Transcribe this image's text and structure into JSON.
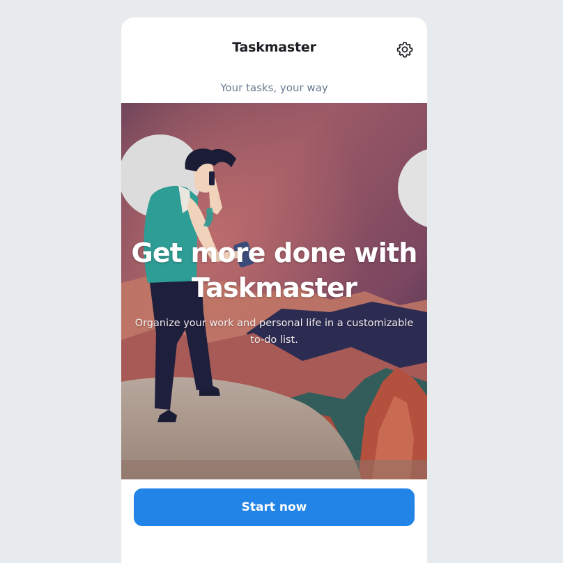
{
  "app": {
    "title": "Taskmaster",
    "tagline": "Your tasks, your way"
  },
  "hero": {
    "heading": "Get more done with Taskmaster",
    "subheading": "Organize your work and personal life in a customizable to-do list.",
    "illustration": "man-on-hill-with-phone"
  },
  "actions": {
    "start_label": "Start now",
    "settings_icon": "gear-icon"
  },
  "colors": {
    "background": "#e8ebee",
    "primary": "#2284e6",
    "title": "#1d1f24",
    "tagline": "#6b7a90"
  }
}
